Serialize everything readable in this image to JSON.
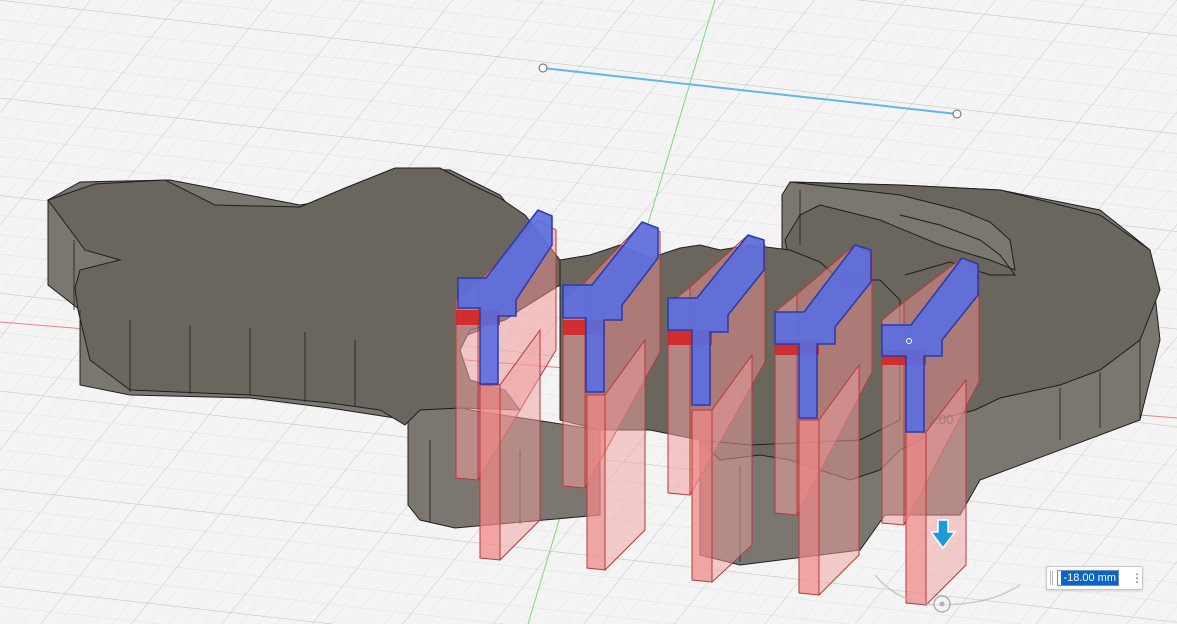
{
  "viewport": {
    "name": "3D model viewport",
    "colors": {
      "background": "#f4f4f4",
      "grid_minor": "#dcdcdc",
      "grid_major": "#c6c6c6",
      "body_top": "#6a665e",
      "body_side": "#7b7770",
      "edge": "#1e1e1e",
      "rib_fill": "#f0a0a0",
      "rib_edge": "#b83838",
      "cap_fill": "#5a6ee0",
      "cap_edge": "#2a3aa8",
      "sketch_line": "#5fb8e8",
      "axis_x": "#f08080",
      "axis_y": "#80d880",
      "arrow": "#1b9bd8"
    },
    "ghost_label": "1.00"
  },
  "dimension": {
    "value": "-18.00 mm",
    "menu_icon": "more-vertical-icon"
  }
}
